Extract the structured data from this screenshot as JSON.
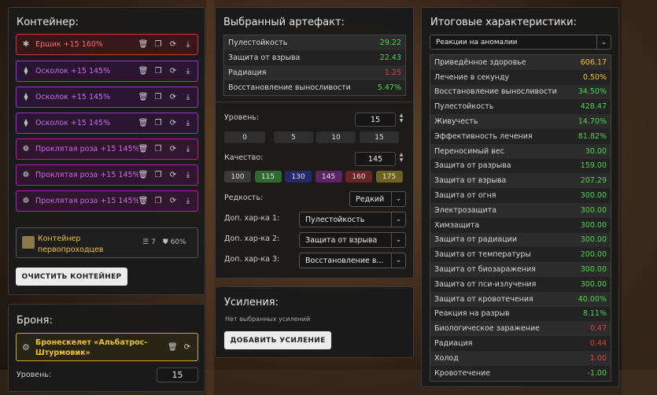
{
  "container": {
    "title": "Контейнер:",
    "items": [
      {
        "name": "Ершик +15 160%",
        "icon": "✱"
      },
      {
        "name": "Осколок +15 145%",
        "icon": "⧫"
      },
      {
        "name": "Осколок +15 145%",
        "icon": "⧫"
      },
      {
        "name": "Осколок +15 145%",
        "icon": "⧫"
      },
      {
        "name": "Проклятая роза +15 145%",
        "icon": "❁"
      },
      {
        "name": "Проклятая роза +15 145%",
        "icon": "❁"
      },
      {
        "name": "Проклятая роза +15 145%",
        "icon": "❁"
      }
    ],
    "selected_container": {
      "line1": "Контейнер",
      "line2": "первопроходцев",
      "slots": "7",
      "protection": "60%"
    },
    "clear_label": "ОЧИСТИТЬ КОНТЕЙНЕР",
    "colors": {
      "red": "#c9383c",
      "purple": "#a52bd4",
      "magenta": "#b21fb0"
    }
  },
  "armor": {
    "title": "Броня:",
    "item_name": "Бронескелет «Альбатрос-Штурмовик»",
    "level_label": "Уровень:",
    "level_value": "15"
  },
  "artifact": {
    "title": "Выбранный артефакт:",
    "stats": [
      {
        "label": "Пулестойкость",
        "value": "29.22",
        "color": "g"
      },
      {
        "label": "Защита от взрыва",
        "value": "22.43",
        "color": "g"
      },
      {
        "label": "Радиация",
        "value": "1.25",
        "color": "r"
      },
      {
        "label": "Восстановление выносливости",
        "value": "5.47%",
        "color": "g"
      }
    ],
    "level_label": "Уровень:",
    "level_value": "15",
    "level_presets": [
      "0",
      "5",
      "10",
      "15"
    ],
    "quality_label": "Качество:",
    "quality_value": "145",
    "quality_presets": [
      {
        "label": "100",
        "color": "#3a3a3a"
      },
      {
        "label": "115",
        "color": "#2f6a2f"
      },
      {
        "label": "130",
        "color": "#232a6a"
      },
      {
        "label": "145",
        "color": "#5a2466"
      },
      {
        "label": "160",
        "color": "#6a2424"
      },
      {
        "label": "175",
        "color": "#6e6222"
      }
    ],
    "rarity_label": "Редкость:",
    "rarity_value": "Редкий",
    "extra1_label": "Доп. хар-ка 1:",
    "extra1_value": "Пулестойкость",
    "extra2_label": "Доп. хар-ка 2:",
    "extra2_value": "Защита от взрыва",
    "extra3_label": "Доп. хар-ка 3:",
    "extra3_value": "Восстановление в..."
  },
  "boosts": {
    "title": "Усиления:",
    "empty_text": "Нет выбранных усилений",
    "add_label": "ДОБАВИТЬ УСИЛЕНИЕ"
  },
  "totals": {
    "title": "Итоговые характеристики:",
    "filter_value": "Реакции на аномалии",
    "stats": [
      {
        "label": "Приведённое здоровье",
        "value": "606.17",
        "color": "y"
      },
      {
        "label": "Лечение в секунду",
        "value": "0.50%",
        "color": "y"
      },
      {
        "label": "Восстановление выносливости",
        "value": "34.50%",
        "color": "g"
      },
      {
        "label": "Пулестойкость",
        "value": "428.47",
        "color": "g"
      },
      {
        "label": "Живучесть",
        "value": "14.70%",
        "color": "g"
      },
      {
        "label": "Эффективность лечения",
        "value": "81.82%",
        "color": "g"
      },
      {
        "label": "Переносимый вес",
        "value": "30.00",
        "color": "g"
      },
      {
        "label": "Защита от разрыва",
        "value": "159.00",
        "color": "g"
      },
      {
        "label": "Защита от взрыва",
        "value": "207.29",
        "color": "g"
      },
      {
        "label": "Защита от огня",
        "value": "300.00",
        "color": "g"
      },
      {
        "label": "Электрозащита",
        "value": "300.00",
        "color": "g"
      },
      {
        "label": "Химзащита",
        "value": "300.00",
        "color": "g"
      },
      {
        "label": "Защита от радиации",
        "value": "300.00",
        "color": "g"
      },
      {
        "label": "Защита от температуры",
        "value": "200.00",
        "color": "g"
      },
      {
        "label": "Защита от биозаражения",
        "value": "300.00",
        "color": "g"
      },
      {
        "label": "Защита от пси-излучения",
        "value": "300.00",
        "color": "g"
      },
      {
        "label": "Защита от кровотечения",
        "value": "40.00%",
        "color": "g"
      },
      {
        "label": "Реакция на разрыв",
        "value": "8.11%",
        "color": "g"
      },
      {
        "label": "Биологическое заражение",
        "value": "0.47",
        "color": "r"
      },
      {
        "label": "Радиация",
        "value": "0.44",
        "color": "r"
      },
      {
        "label": "Холод",
        "value": "1.00",
        "color": "r"
      },
      {
        "label": "Кровотечение",
        "value": "-1.00",
        "color": "g"
      }
    ]
  }
}
